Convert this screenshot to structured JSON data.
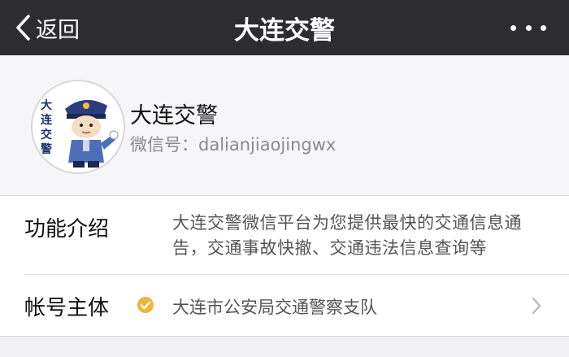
{
  "nav": {
    "back_label": "返回",
    "title": "大连交警",
    "more_icon": "ellipsis-icon",
    "back_icon": "chevron-left-icon"
  },
  "profile": {
    "name": "大连交警",
    "wechat_id": "微信号：dalianjiaojingwx",
    "avatar_text": [
      "大",
      "连",
      "交",
      "警"
    ]
  },
  "info": {
    "intro_label": "功能介绍",
    "intro_text": "大连交警微信平台为您提供最快的交通信息通告，交通事故快撤、交通违法信息查询等",
    "owner_label": "帐号主体",
    "owner_text": "大连市公安局交通警察支队",
    "verified_icon": "verified-check-icon"
  },
  "colors": {
    "nav_bg": "#2d2d31",
    "page_bg": "#efeff4",
    "verified": "#f0b43c"
  }
}
